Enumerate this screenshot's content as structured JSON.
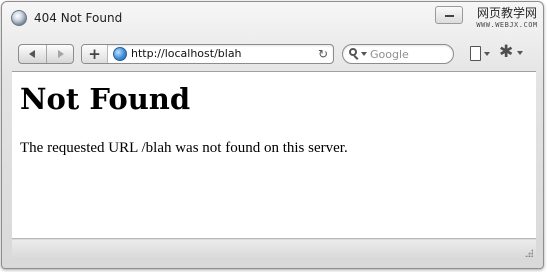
{
  "window": {
    "title": "404 Not Found",
    "watermark_main": "网页教学网",
    "watermark_sub": "WWW.WEBJX.COM"
  },
  "toolbar": {
    "url": "http://localhost/blah",
    "add_label": "+",
    "reload_glyph": "↻",
    "search": {
      "placeholder": "Google"
    }
  },
  "page": {
    "heading": "Not Found",
    "message": "The requested URL /blah was not found on this server."
  },
  "icons": {
    "app": "browser-app-icon",
    "back": "back-arrow-icon",
    "forward": "forward-arrow-icon",
    "site": "globe-icon",
    "reload": "reload-icon",
    "search": "search-icon",
    "page_menu": "page-menu-icon",
    "settings": "settings-icon"
  },
  "colors": {
    "window_frame": "#8e8e8e",
    "chrome_bg": "#dcdcdc",
    "globe": "#3f8fd8"
  }
}
